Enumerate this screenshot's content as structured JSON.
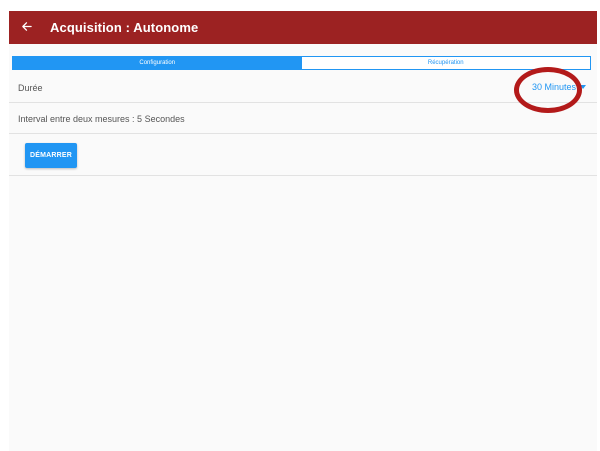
{
  "appbar": {
    "title": "Acquisition : Autonome",
    "back_icon": "arrow-left-icon",
    "color": "#9c2222"
  },
  "tabs": [
    {
      "label": "Configuration",
      "active": true
    },
    {
      "label": "Récupération",
      "active": false
    }
  ],
  "settings": {
    "duration": {
      "label": "Durée",
      "selected": "30 Minutes"
    },
    "interval_text": "Interval entre deux mesures : 5 Secondes"
  },
  "actions": {
    "start_label": "DÉMARRER"
  },
  "colors": {
    "accent": "#2196f3",
    "highlight": "#b31a1a"
  }
}
